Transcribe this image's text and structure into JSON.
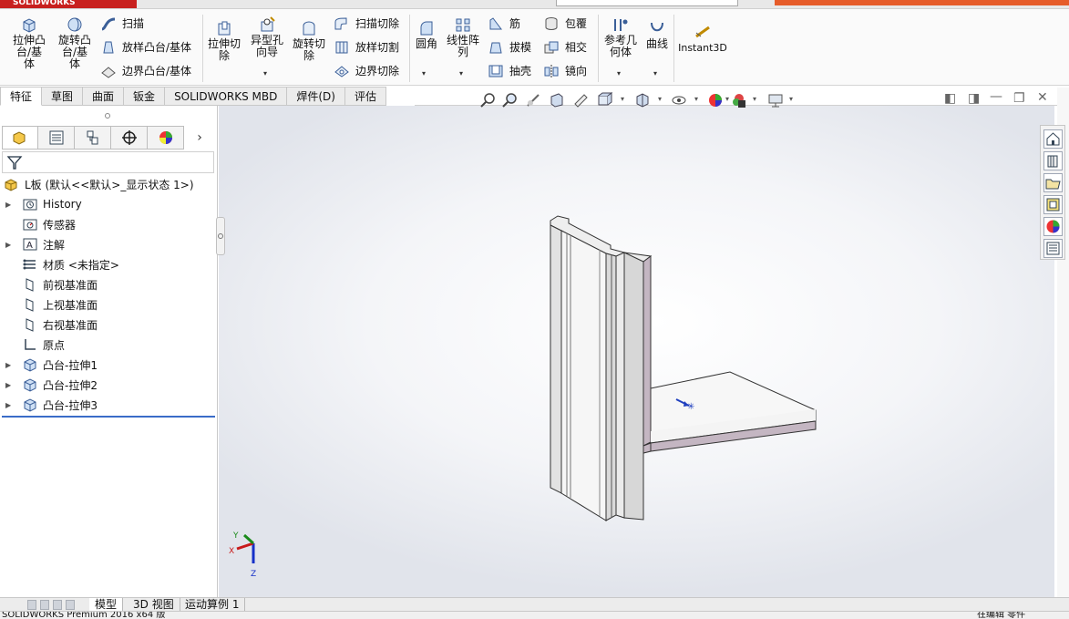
{
  "window": {
    "app_name": "SOLIDWORKS",
    "status_text": "SOLIDWORKS Premium 2016 x64 版",
    "status_right": "在编辑 零件"
  },
  "ribbon": {
    "extrude_boss": "拉伸凸台/基体",
    "revolve_boss": "旋转凸台/基体",
    "sweep": "扫描",
    "loft_boss": "放样凸台/基体",
    "boundary_boss": "边界凸台/基体",
    "extrude_cut": "拉伸切除",
    "hole_wizard": "异型孔向导",
    "revolve_cut": "旋转切除",
    "swept_cut": "扫描切除",
    "lofted_cut": "放样切割",
    "boundary_cut": "边界切除",
    "fillet": "圆角",
    "linear_pattern": "线性阵列",
    "rib": "筋",
    "draft": "拔模",
    "shell": "抽壳",
    "wrap": "包覆",
    "intersect": "相交",
    "mirror": "镜向",
    "reference_geometry": "参考几何体",
    "curves": "曲线",
    "instant3d": "Instant3D"
  },
  "tabs": [
    "特征",
    "草图",
    "曲面",
    "钣金",
    "SOLIDWORKS MBD",
    "焊件(D)",
    "评估"
  ],
  "feature_tree": {
    "root": "L板  (默认<<默认>_显示状态 1>)",
    "items": [
      {
        "label": "History",
        "icon": "history-folder-icon",
        "expandable": true
      },
      {
        "label": "传感器",
        "icon": "sensor-icon",
        "expandable": false
      },
      {
        "label": "注解",
        "icon": "annotation-icon",
        "expandable": true
      },
      {
        "label": "材质 <未指定>",
        "icon": "material-icon",
        "expandable": false
      },
      {
        "label": "前视基准面",
        "icon": "plane-icon",
        "expandable": false
      },
      {
        "label": "上视基准面",
        "icon": "plane-icon",
        "expandable": false
      },
      {
        "label": "右视基准面",
        "icon": "plane-icon",
        "expandable": false
      },
      {
        "label": "原点",
        "icon": "origin-icon",
        "expandable": false
      },
      {
        "label": "凸台-拉伸1",
        "icon": "extrude-feature-icon",
        "expandable": true
      },
      {
        "label": "凸台-拉伸2",
        "icon": "extrude-feature-icon",
        "expandable": true
      },
      {
        "label": "凸台-拉伸3",
        "icon": "extrude-feature-icon",
        "expandable": true
      }
    ]
  },
  "triad": {
    "x": "X",
    "y": "Y",
    "z": "Z"
  },
  "bottom_tabs": [
    "模型",
    "3D 视图",
    "运动算例 1"
  ],
  "colors": {
    "part_face": "#f3f3f3",
    "part_side": "#c4b6c2",
    "selection_line": "#3a6cc8",
    "brand": "#c8201e"
  }
}
